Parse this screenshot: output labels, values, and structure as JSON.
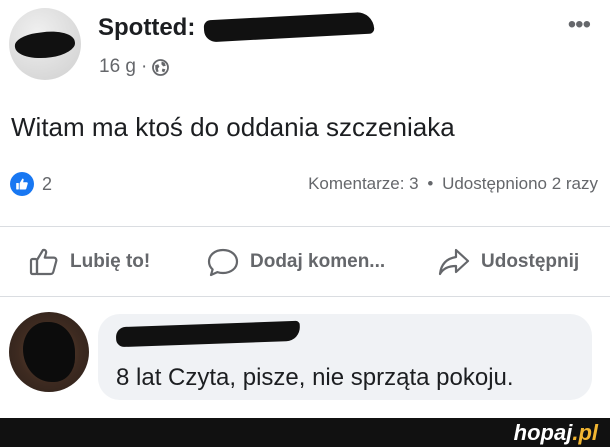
{
  "post": {
    "author_prefix": "Spotted:",
    "time": "16 g",
    "separator": "·",
    "text": "Witam ma ktoś do oddania szczeniaka",
    "more_glyph": "•••"
  },
  "stats": {
    "reactions_count": "2",
    "comments": "Komentarze: 3",
    "dot": "•",
    "shares": "Udostępniono 2 razy"
  },
  "actions": {
    "like": "Lubię to!",
    "comment": "Dodaj komen...",
    "share": "Udostępnij"
  },
  "comment": {
    "text": "8 lat Czyta, pisze, nie sprząta pokoju."
  },
  "footer": {
    "logo_main": "hopaj",
    "logo_tld": ".pl"
  },
  "colors": {
    "brand_blue": "#1877f2",
    "secondary_text": "#65676b",
    "bubble_bg": "#f0f2f5",
    "footer_bg": "#111111",
    "footer_accent": "#f2b632"
  },
  "icons": {
    "privacy": "globe-icon",
    "menu": "more-options-icon",
    "reaction": "like-reaction-icon",
    "like": "thumbs-up-icon",
    "comment": "comment-bubble-icon",
    "share": "share-arrow-icon"
  }
}
